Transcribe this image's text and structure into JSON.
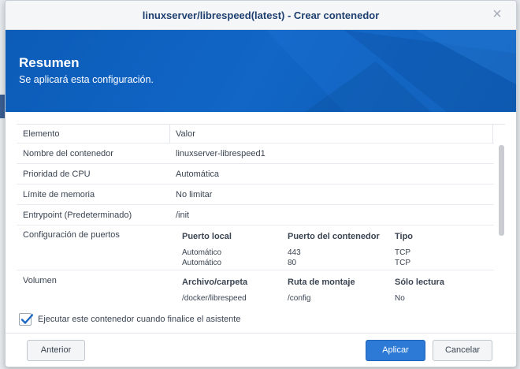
{
  "window": {
    "title": "linuxserver/librespeed(latest) - Crear contenedor",
    "close_glyph": "×"
  },
  "banner": {
    "title": "Resumen",
    "subtitle": "Se aplicará esta configuración."
  },
  "table": {
    "headers": {
      "key": "Elemento",
      "value": "Valor"
    },
    "rows": [
      {
        "key": "Nombre del contenedor",
        "value": "linuxserver-librespeed1"
      },
      {
        "key": "Prioridad de CPU",
        "value": "Automática"
      },
      {
        "key": "Límite de memoria",
        "value": "No limitar"
      },
      {
        "key": "Entrypoint (Predeterminado)",
        "value": "/init"
      }
    ],
    "ports": {
      "key": "Configuración de puertos",
      "headers": [
        "Puerto local",
        "Puerto del contenedor",
        "Tipo"
      ],
      "rows": [
        [
          "Automático",
          "443",
          "TCP"
        ],
        [
          "Automático",
          "80",
          "TCP"
        ]
      ]
    },
    "volume": {
      "key": "Volumen",
      "headers": [
        "Archivo/carpeta",
        "Ruta de montaje",
        "Sólo lectura"
      ],
      "rows": [
        [
          "/docker/librespeed",
          "/config",
          "No"
        ]
      ]
    }
  },
  "checkbox": {
    "label": "Ejecutar este contenedor cuando finalice el asistente",
    "checked": true
  },
  "buttons": {
    "previous": "Anterior",
    "apply": "Aplicar",
    "cancel": "Cancelar"
  },
  "colors": {
    "accent": "#2d7ad6",
    "banner": "#0c5cb8",
    "title_text": "#1f3f70"
  }
}
